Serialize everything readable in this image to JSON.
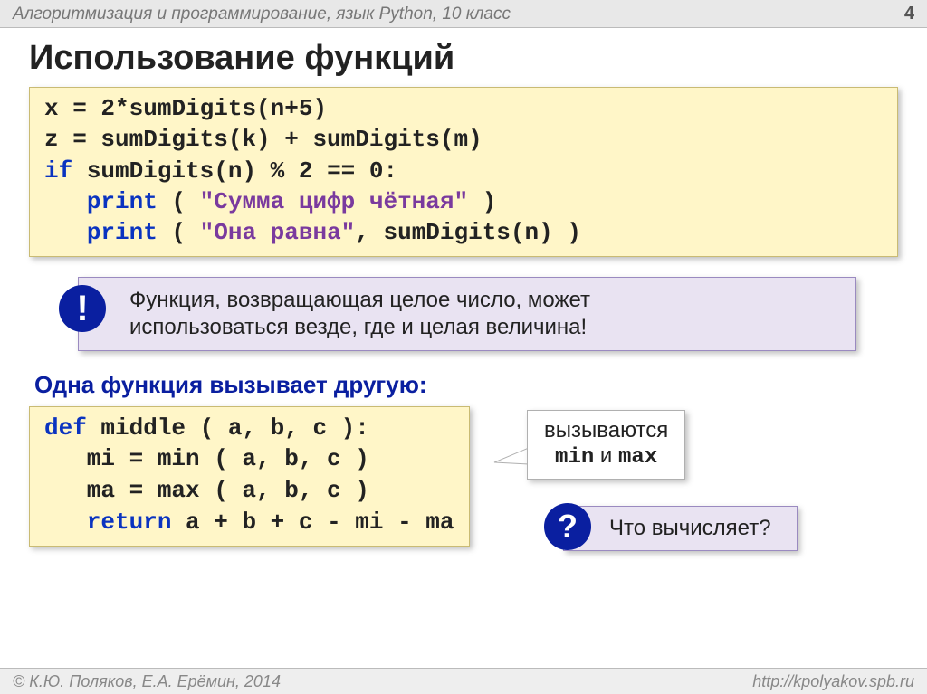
{
  "header": {
    "course": "Алгоритмизация и программирование, язык Python, 10 класс",
    "page": "4"
  },
  "title": "Использование функций",
  "code1": {
    "l1a": "x = ",
    "l1b": "2",
    "l1c": "*sumDigits(n+5)",
    "l2": "z = sumDigits(k) + sumDigits(m)",
    "l3a": "if",
    "l3b": " sumDigits(n) % ",
    "l3c": "2",
    "l3d": " == ",
    "l3e": "0",
    "l3f": ":",
    "l4a": "   ",
    "l4b": "print",
    "l4c": " ( ",
    "l4d": "\"Сумма цифр чётная\"",
    "l4e": " )",
    "l5a": "   ",
    "l5b": "print",
    "l5c": " ( ",
    "l5d": "\"Она равна\"",
    "l5e": ", sumDigits(n) )"
  },
  "callout": {
    "badge": "!",
    "text1": "Функция, возвращающая целое число, может",
    "text2": "использоваться везде, где и целая величина!"
  },
  "subhead": "Одна функция вызывает другую:",
  "code2": {
    "l1a": "def",
    "l1b": " middle ( a, b, c ):",
    "l2": "   mi = min ( a, b, c ) ",
    "l3": "   ma = max ( a, b, c )",
    "l4a": "   ",
    "l4b": "return",
    "l4c": " a + b + c - mi - ma"
  },
  "note": {
    "line1": "вызываются",
    "min": "min",
    "and": " и ",
    "max": "max"
  },
  "question": {
    "badge": "?",
    "text": "Что вычисляет?"
  },
  "footer": {
    "authors": "© К.Ю. Поляков, Е.А. Ерёмин, 2014",
    "url": "http://kpolyakov.spb.ru"
  }
}
